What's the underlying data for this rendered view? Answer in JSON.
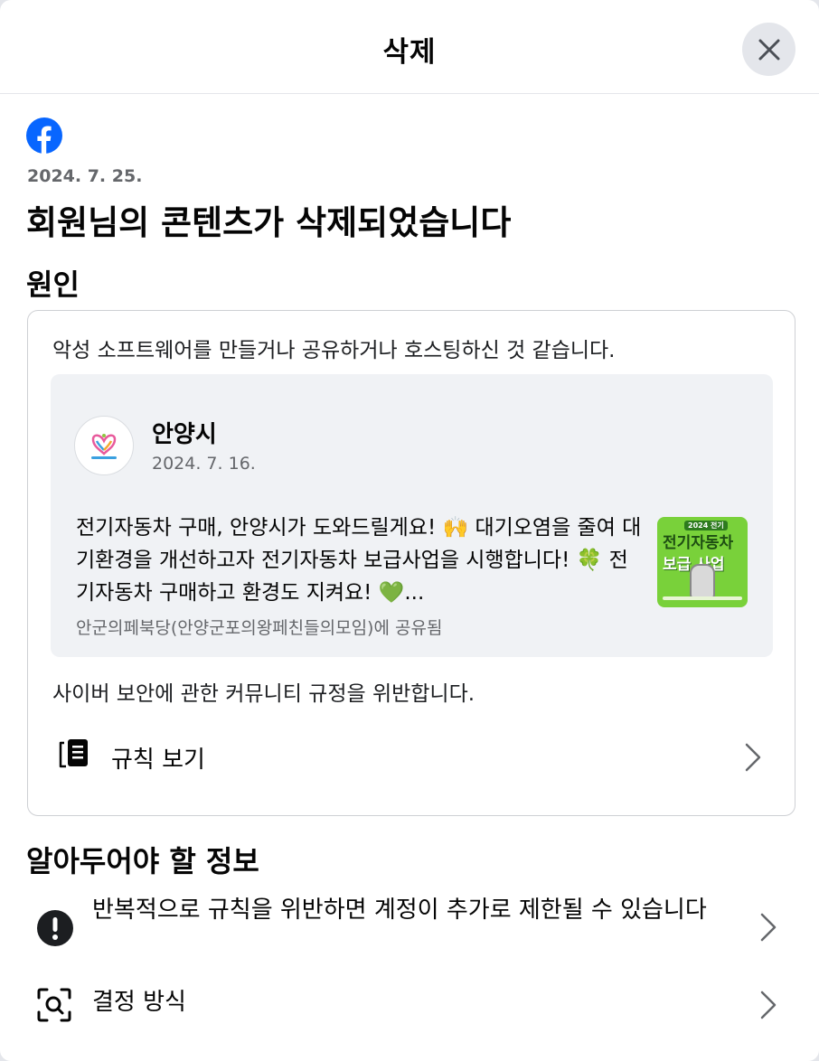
{
  "header": {
    "title": "삭제"
  },
  "notice": {
    "date": "2024. 7. 25.",
    "title": "회원님의 콘텐츠가 삭제되었습니다"
  },
  "reason_section": {
    "heading": "원인",
    "reason_text": "악성 소프트웨어를 만들거나 공유하거나 호스팅하신 것 같습니다.",
    "post": {
      "author": "안양시",
      "date": "2024. 7. 16.",
      "body": "전기자동차 구매, 안양시가 도와드릴게요! 🙌 대기오염을 줄여 대기환경을 개선하고자 전기자동차 보급사업을 시행합니다! 🍀 전기자동차 구매하고 환경도 지켜요! 💚...",
      "shared_in": "안군의페북당(안양군포의왕페친들의모임)에 공유됨",
      "thumbnail": {
        "tag": "2024 전기",
        "line1": "전기자동차",
        "line2": "보급 사업"
      }
    },
    "violation_text": "사이버 보안에 관한 커뮤니티 규정을 위반합니다.",
    "rules_label": "규칙 보기"
  },
  "info_section": {
    "heading": "알아두어야 할 정보",
    "items": [
      {
        "label": "반복적으로 규칙을 위반하면 계정이 추가로 제한될 수 있습니다",
        "icon": "exclamation-icon"
      },
      {
        "label": "결정 방식",
        "icon": "search-scan-icon"
      }
    ]
  },
  "colors": {
    "facebook_blue": "#0866ff",
    "secondary_text": "#65676b",
    "card_background": "#f0f2f5",
    "divider": "#e4e6eb"
  }
}
